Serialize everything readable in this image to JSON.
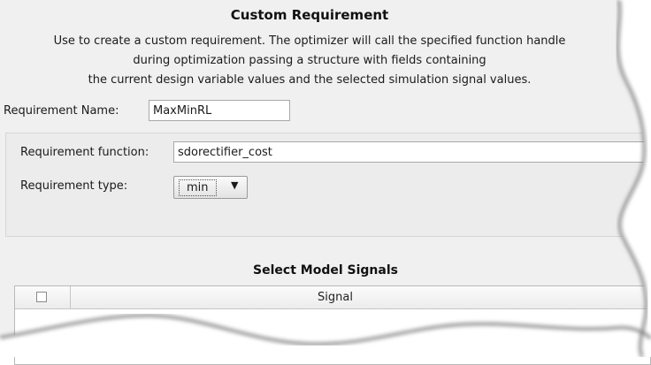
{
  "dialog": {
    "title": "Custom Requirement",
    "description_lines": [
      "Use to create a custom requirement. The optimizer will call the specified function handle",
      "during optimization passing a structure with fields containing",
      "the current design variable values and the selected simulation signal values."
    ]
  },
  "requirement_name": {
    "label": "Requirement Name:",
    "value": "MaxMinRL"
  },
  "requirement_function": {
    "label": "Requirement function:",
    "value": "sdorectifier_cost"
  },
  "requirement_type": {
    "label": "Requirement type:",
    "selected": "min"
  },
  "signals": {
    "section_title": "Select Model Signals",
    "columns": [
      "",
      "Signal"
    ],
    "select_all_checked": false
  },
  "icons": {
    "dropdown": "chevron-down-icon",
    "checkbox": "checkbox-icon"
  },
  "colors": {
    "panel_background": "#f0f0f0",
    "input_border": "#a9a9a9",
    "shadow": "#7a7a7a"
  }
}
